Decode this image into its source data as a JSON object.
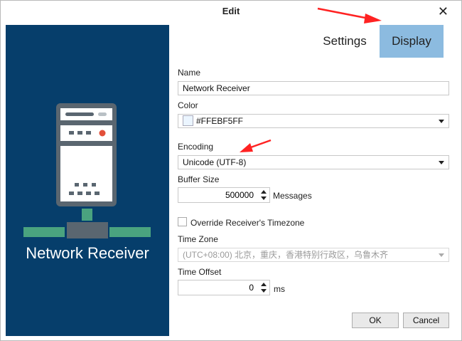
{
  "window": {
    "title": "Edit",
    "close_glyph": "✕"
  },
  "left_panel": {
    "caption": "Network Receiver",
    "bg": "#063e6b",
    "accent": "#4aa37f",
    "icon": "server-network-icon"
  },
  "tabs": [
    {
      "label": "Settings",
      "active": false
    },
    {
      "label": "Display",
      "active": true
    }
  ],
  "form": {
    "name": {
      "label": "Name",
      "value": "Network Receiver"
    },
    "color": {
      "label": "Color",
      "value": "#FFEBF5FF"
    },
    "encoding": {
      "label": "Encoding",
      "value": "Unicode (UTF-8)"
    },
    "buffer_size": {
      "label": "Buffer Size",
      "value": "500000",
      "unit": "Messages"
    },
    "override_tz": {
      "label": "Override Receiver's Timezone",
      "checked": false
    },
    "time_zone": {
      "label": "Time Zone",
      "value": "(UTC+08:00) 北京，重庆，香港特别行政区，乌鲁木齐",
      "disabled": true
    },
    "time_offset": {
      "label": "Time Offset",
      "value": "0",
      "unit": "ms"
    }
  },
  "buttons": {
    "ok": "OK",
    "cancel": "Cancel"
  }
}
